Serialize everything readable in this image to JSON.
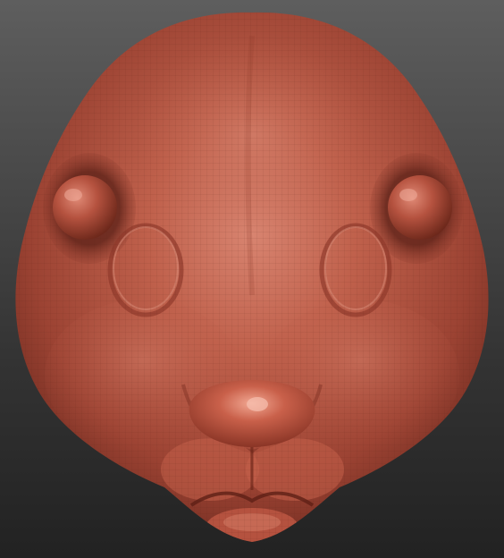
{
  "viewport": {
    "subject": "sculpted-head-model",
    "material_color": "#b5523f",
    "background_top": "#5e5e5e",
    "background_bottom": "#222222"
  }
}
